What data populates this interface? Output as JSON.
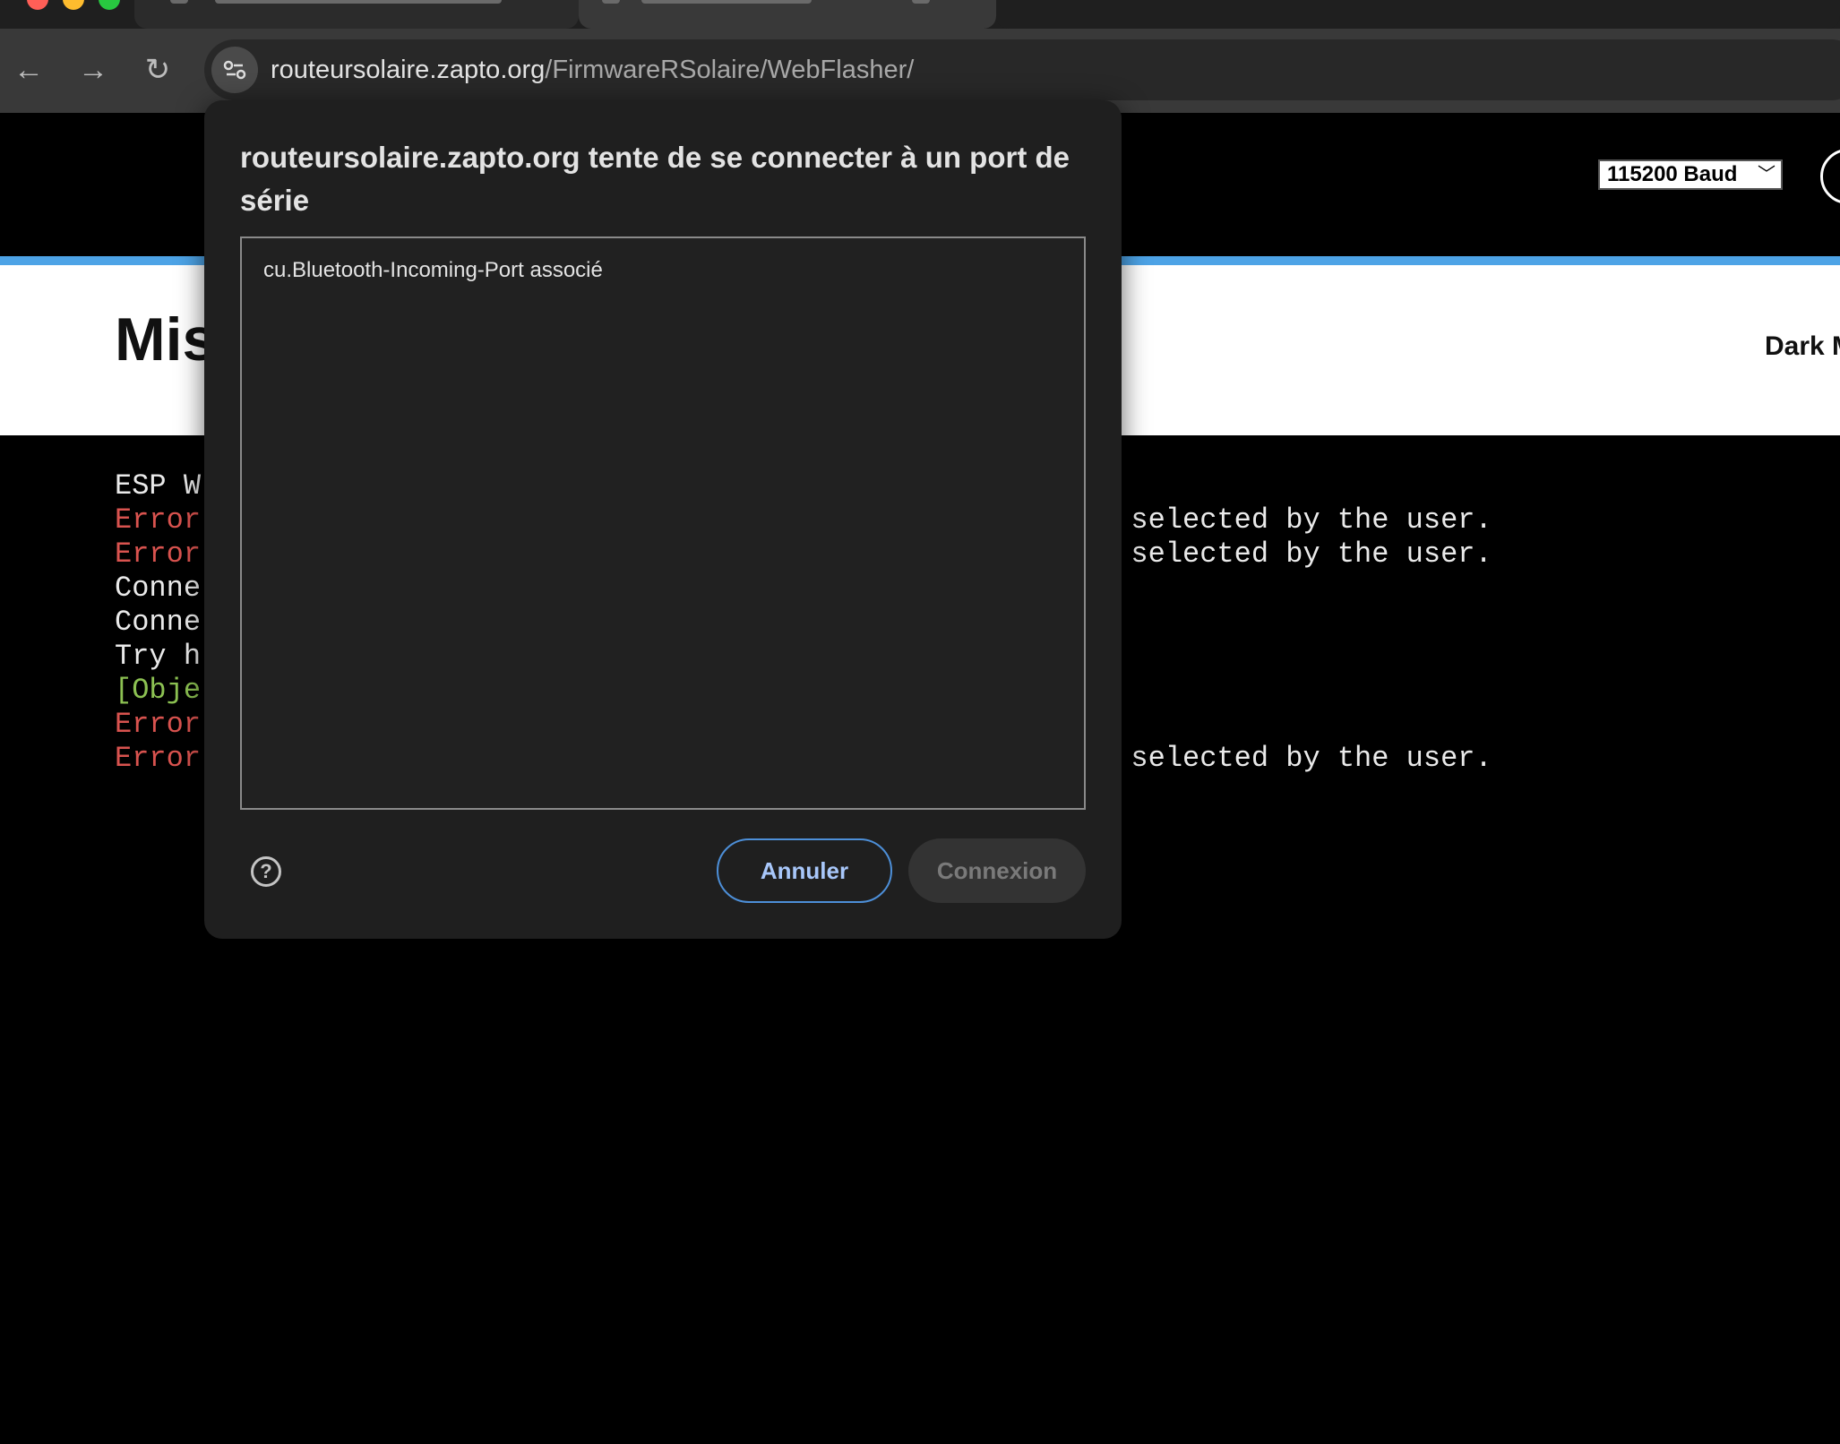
{
  "browser": {
    "url_host": "routeursolaire.zapto.org",
    "url_path": "/FirmwareRSolaire/WebFlasher/",
    "traffic_colors": {
      "close": "#ff5f57",
      "minimize": "#febc2e",
      "maximize": "#28c840"
    },
    "nav": {
      "back_icon": "←",
      "forward_icon": "→",
      "reload_icon": "↻"
    }
  },
  "header": {
    "baud_select": "115200 Baud",
    "page_title": "Mis",
    "dark_mode_label": "Dark M",
    "accent_color": "#4da3e6"
  },
  "console": {
    "lines": [
      {
        "text": "ESP W",
        "suffix": "",
        "type": "info"
      },
      {
        "text": "Error",
        "suffix": "t selected by the user.",
        "type": "error"
      },
      {
        "text": "Error",
        "suffix": "t selected by the user.",
        "type": "error"
      },
      {
        "text": "Conne",
        "suffix": "",
        "type": "info"
      },
      {
        "text": "Conne",
        "suffix": "",
        "type": "info"
      },
      {
        "text": "Try h",
        "suffix": "",
        "type": "info"
      },
      {
        "text": "[Obje",
        "suffix": "",
        "type": "object"
      },
      {
        "text": "Error",
        "suffix": "",
        "type": "error"
      },
      {
        "text": "Error",
        "suffix": "t selected by the user.",
        "type": "error"
      }
    ]
  },
  "dialog": {
    "title": "routeursolaire.zapto.org tente de se connecter à un port de série",
    "ports": [
      "cu.Bluetooth-Incoming-Port associé"
    ],
    "help_icon": "?",
    "cancel_label": "Annuler",
    "connect_label": "Connexion"
  }
}
